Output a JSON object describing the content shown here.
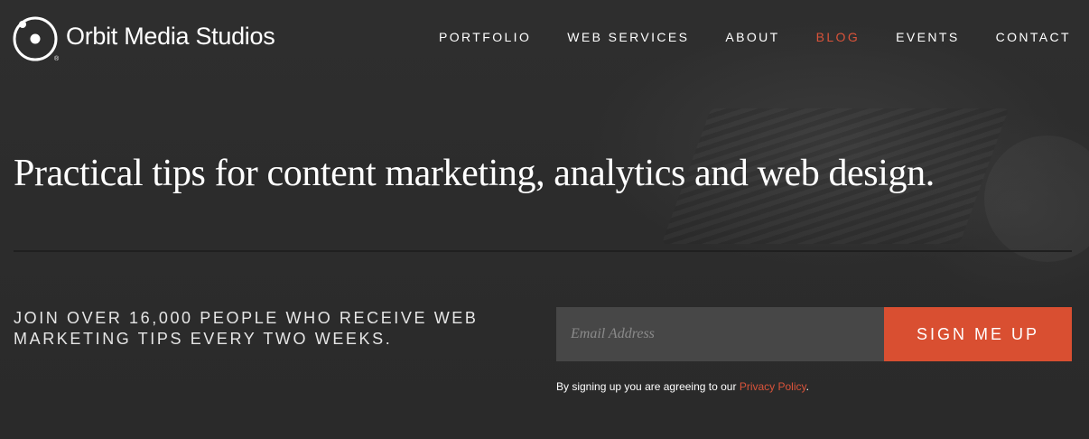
{
  "brand": {
    "name": "Orbit Media Studios",
    "registered_mark": "®",
    "logo_icon": "orbit-logo-icon"
  },
  "nav": {
    "items": [
      {
        "label": "PORTFOLIO",
        "active": false
      },
      {
        "label": "WEB SERVICES",
        "active": false
      },
      {
        "label": "ABOUT",
        "active": false
      },
      {
        "label": "BLOG",
        "active": true
      },
      {
        "label": "EVENTS",
        "active": false
      },
      {
        "label": "CONTACT",
        "active": false
      }
    ]
  },
  "hero": {
    "headline": "Practical tips for content marketing, analytics and web design."
  },
  "newsletter": {
    "pitch_line1": "JOIN OVER 16,000 PEOPLE WHO RECEIVE WEB",
    "pitch_line2": "MARKETING TIPS EVERY TWO WEEKS.",
    "email_placeholder": "Email Address",
    "email_value": "",
    "button_label": "SIGN ME UP",
    "legal_prefix": "By signing up you are agreeing to our ",
    "legal_link": "Privacy Policy",
    "legal_suffix": "."
  },
  "colors": {
    "accent": "#d94f31",
    "background": "#2c2c2c",
    "input_bg": "#474747"
  }
}
